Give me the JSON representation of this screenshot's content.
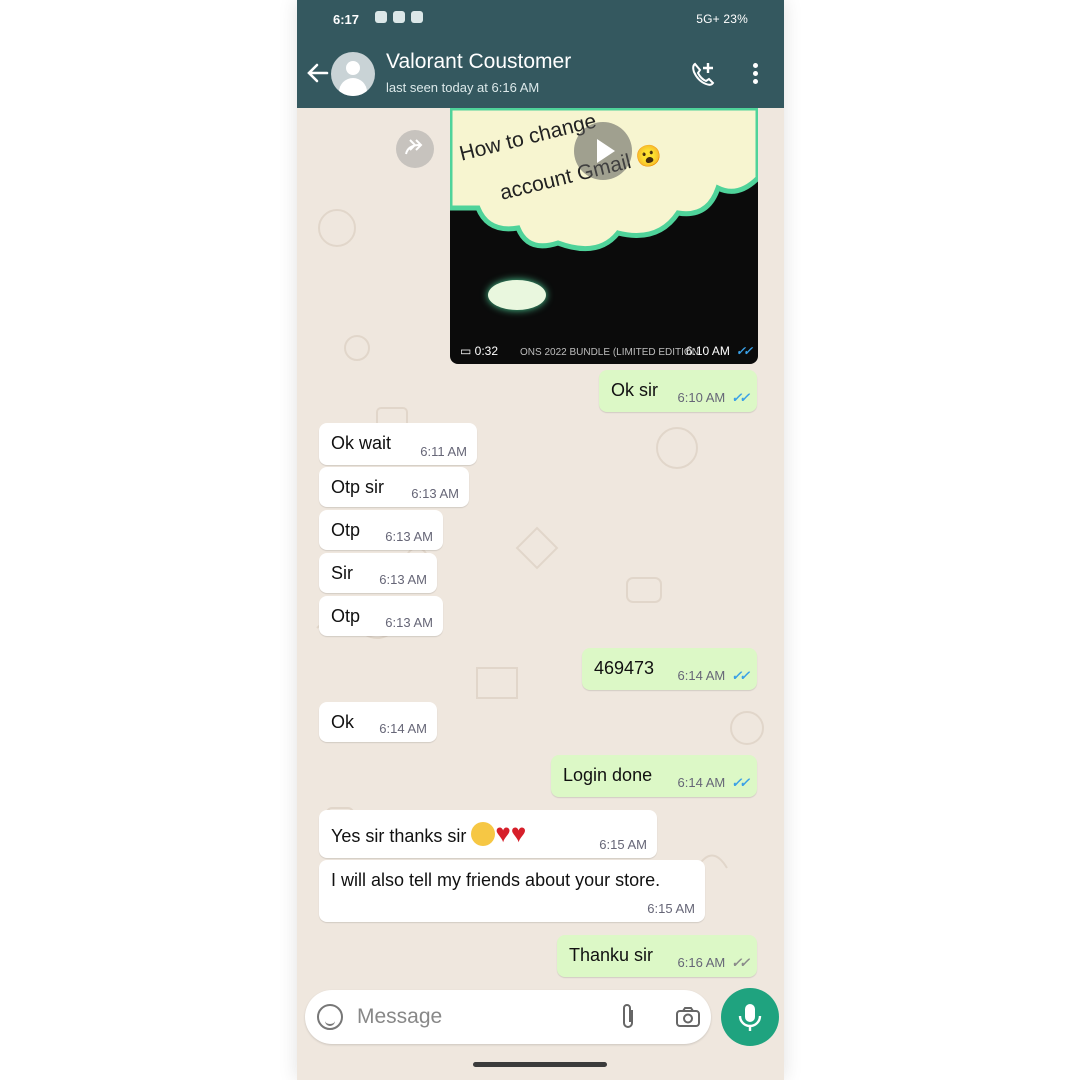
{
  "status_bar": {
    "time": "6:17",
    "right": "5G+ 23%"
  },
  "header": {
    "contact_name": "Valorant Coustomer",
    "last_seen": "last seen today at 6:16 AM"
  },
  "video_message": {
    "overlay_line1": "How to change",
    "overlay_line2": "account Gmail 😮",
    "duration": "0:32",
    "caption": "ONS 2022 BUNDLE (LIMITED EDITION",
    "time": "6:10 AM"
  },
  "messages": [
    {
      "text": "Ok sir",
      "time": "6:10 AM",
      "dir": "out"
    },
    {
      "text": "Ok wait",
      "time": "6:11 AM",
      "dir": "in"
    },
    {
      "text": "Otp sir",
      "time": "6:13 AM",
      "dir": "in"
    },
    {
      "text": "Otp",
      "time": "6:13 AM",
      "dir": "in"
    },
    {
      "text": "Sir",
      "time": "6:13 AM",
      "dir": "in"
    },
    {
      "text": "Otp",
      "time": "6:13 AM",
      "dir": "in"
    },
    {
      "text": "469473",
      "time": "6:14 AM",
      "dir": "out"
    },
    {
      "text": "Ok",
      "time": "6:14 AM",
      "dir": "in"
    },
    {
      "text": "Login done",
      "time": "6:14 AM",
      "dir": "out"
    },
    {
      "text": "Yes sir thanks sir",
      "time": "6:15 AM",
      "dir": "in"
    },
    {
      "text": "I will also tell my friends about your store.",
      "time": "6:15 AM",
      "dir": "in"
    },
    {
      "text": "Thanku sir",
      "time": "6:16 AM",
      "dir": "out"
    }
  ],
  "composer": {
    "placeholder": "Message"
  },
  "colors": {
    "header": "#34585f",
    "outgoing": "#dcf8c6",
    "incoming": "#ffffff",
    "mic": "#1fa37f",
    "read_tick": "#3aa0e6"
  },
  "icons": [
    "back-arrow-icon",
    "avatar-icon",
    "add-call-icon",
    "more-vert-icon",
    "forward-icon",
    "play-icon",
    "video-icon",
    "double-tick-icon",
    "emoji-icon",
    "attach-icon",
    "camera-icon",
    "mic-icon"
  ]
}
